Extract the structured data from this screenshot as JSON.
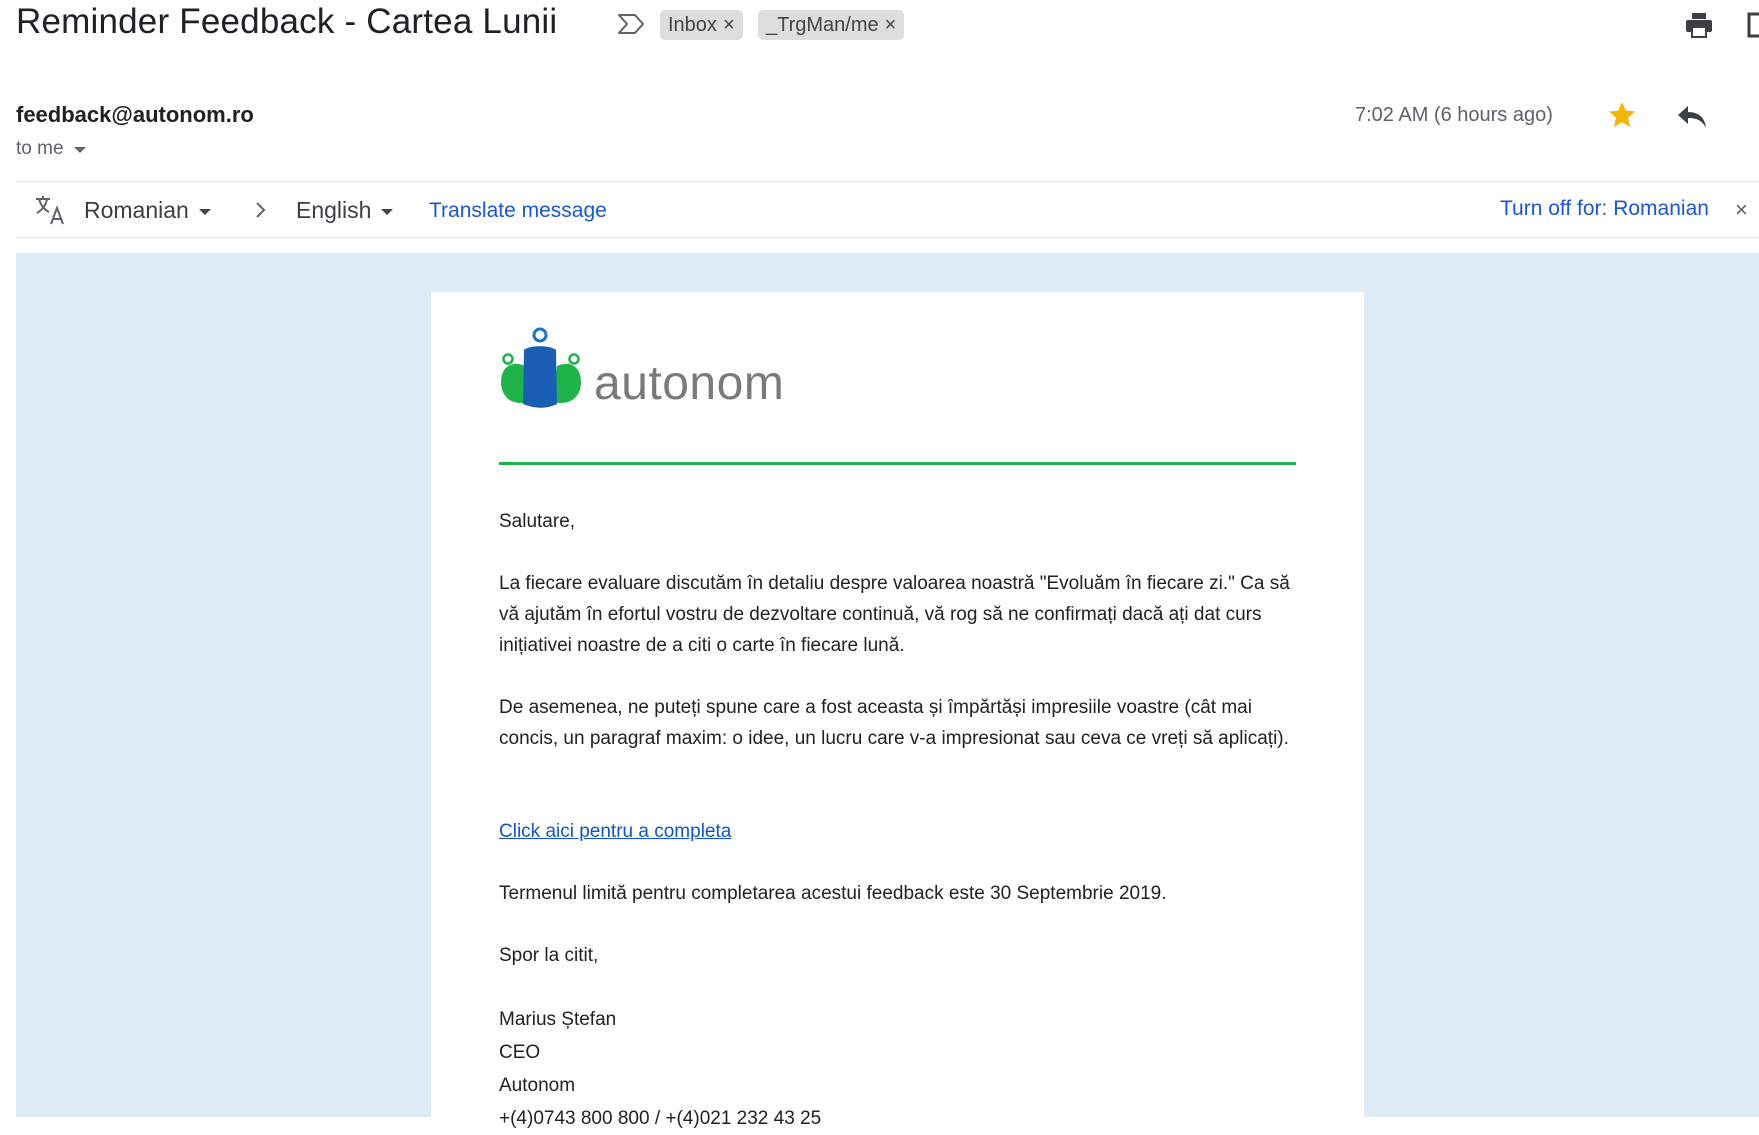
{
  "subject": "Reminder Feedback - Cartea Lunii",
  "labels": [
    {
      "name": "Inbox",
      "remove": "×"
    },
    {
      "name": "_TrgMan/me",
      "remove": "×"
    }
  ],
  "sender": {
    "email": "feedback@autonom.ro",
    "recipient": "to me",
    "time": "7:02 AM (6 hours ago)"
  },
  "translate": {
    "from_language": "Romanian",
    "to_language": "English",
    "translate_link": "Translate message",
    "turn_off": "Turn off for: Romanian",
    "close": "×"
  },
  "email_body": {
    "logo_text": "autonom",
    "greeting": "Salutare,",
    "paragraph1": "La fiecare evaluare discutăm în detaliu despre valoarea noastră \"Evoluăm în fiecare zi.\" Ca să vă ajutăm în efortul vostru de dezvoltare continuă, vă rog să ne confirmați dacă ați dat curs inițiativei noastre de a citi o carte în fiecare lună.",
    "paragraph2": "De asemenea, ne puteți spune care a fost aceasta și împărtăși impresiile voastre (cât mai concis, un paragraf maxim: o idee, un lucru care v-a impresionat sau ceva ce vreți să aplicați).",
    "link": "Click aici pentru a completa",
    "deadline": "Termenul limită pentru completarea acestui feedback este 30 Septembrie 2019.",
    "closing": "Spor la citit,",
    "signature": {
      "name": "Marius Ștefan",
      "title": "CEO",
      "company": "Autonom",
      "phone": "+(4)0743 800 800 / +(4)021 232 43 25"
    }
  },
  "colors": {
    "link": "#1155cc",
    "accent_green": "#1fb44a",
    "star": "#f4b400",
    "panel_bg": "#deebf4"
  },
  "icons": [
    "important-icon",
    "print-icon",
    "new-window-icon",
    "star-icon",
    "reply-icon",
    "translate-icon",
    "chevron-right-icon"
  ]
}
